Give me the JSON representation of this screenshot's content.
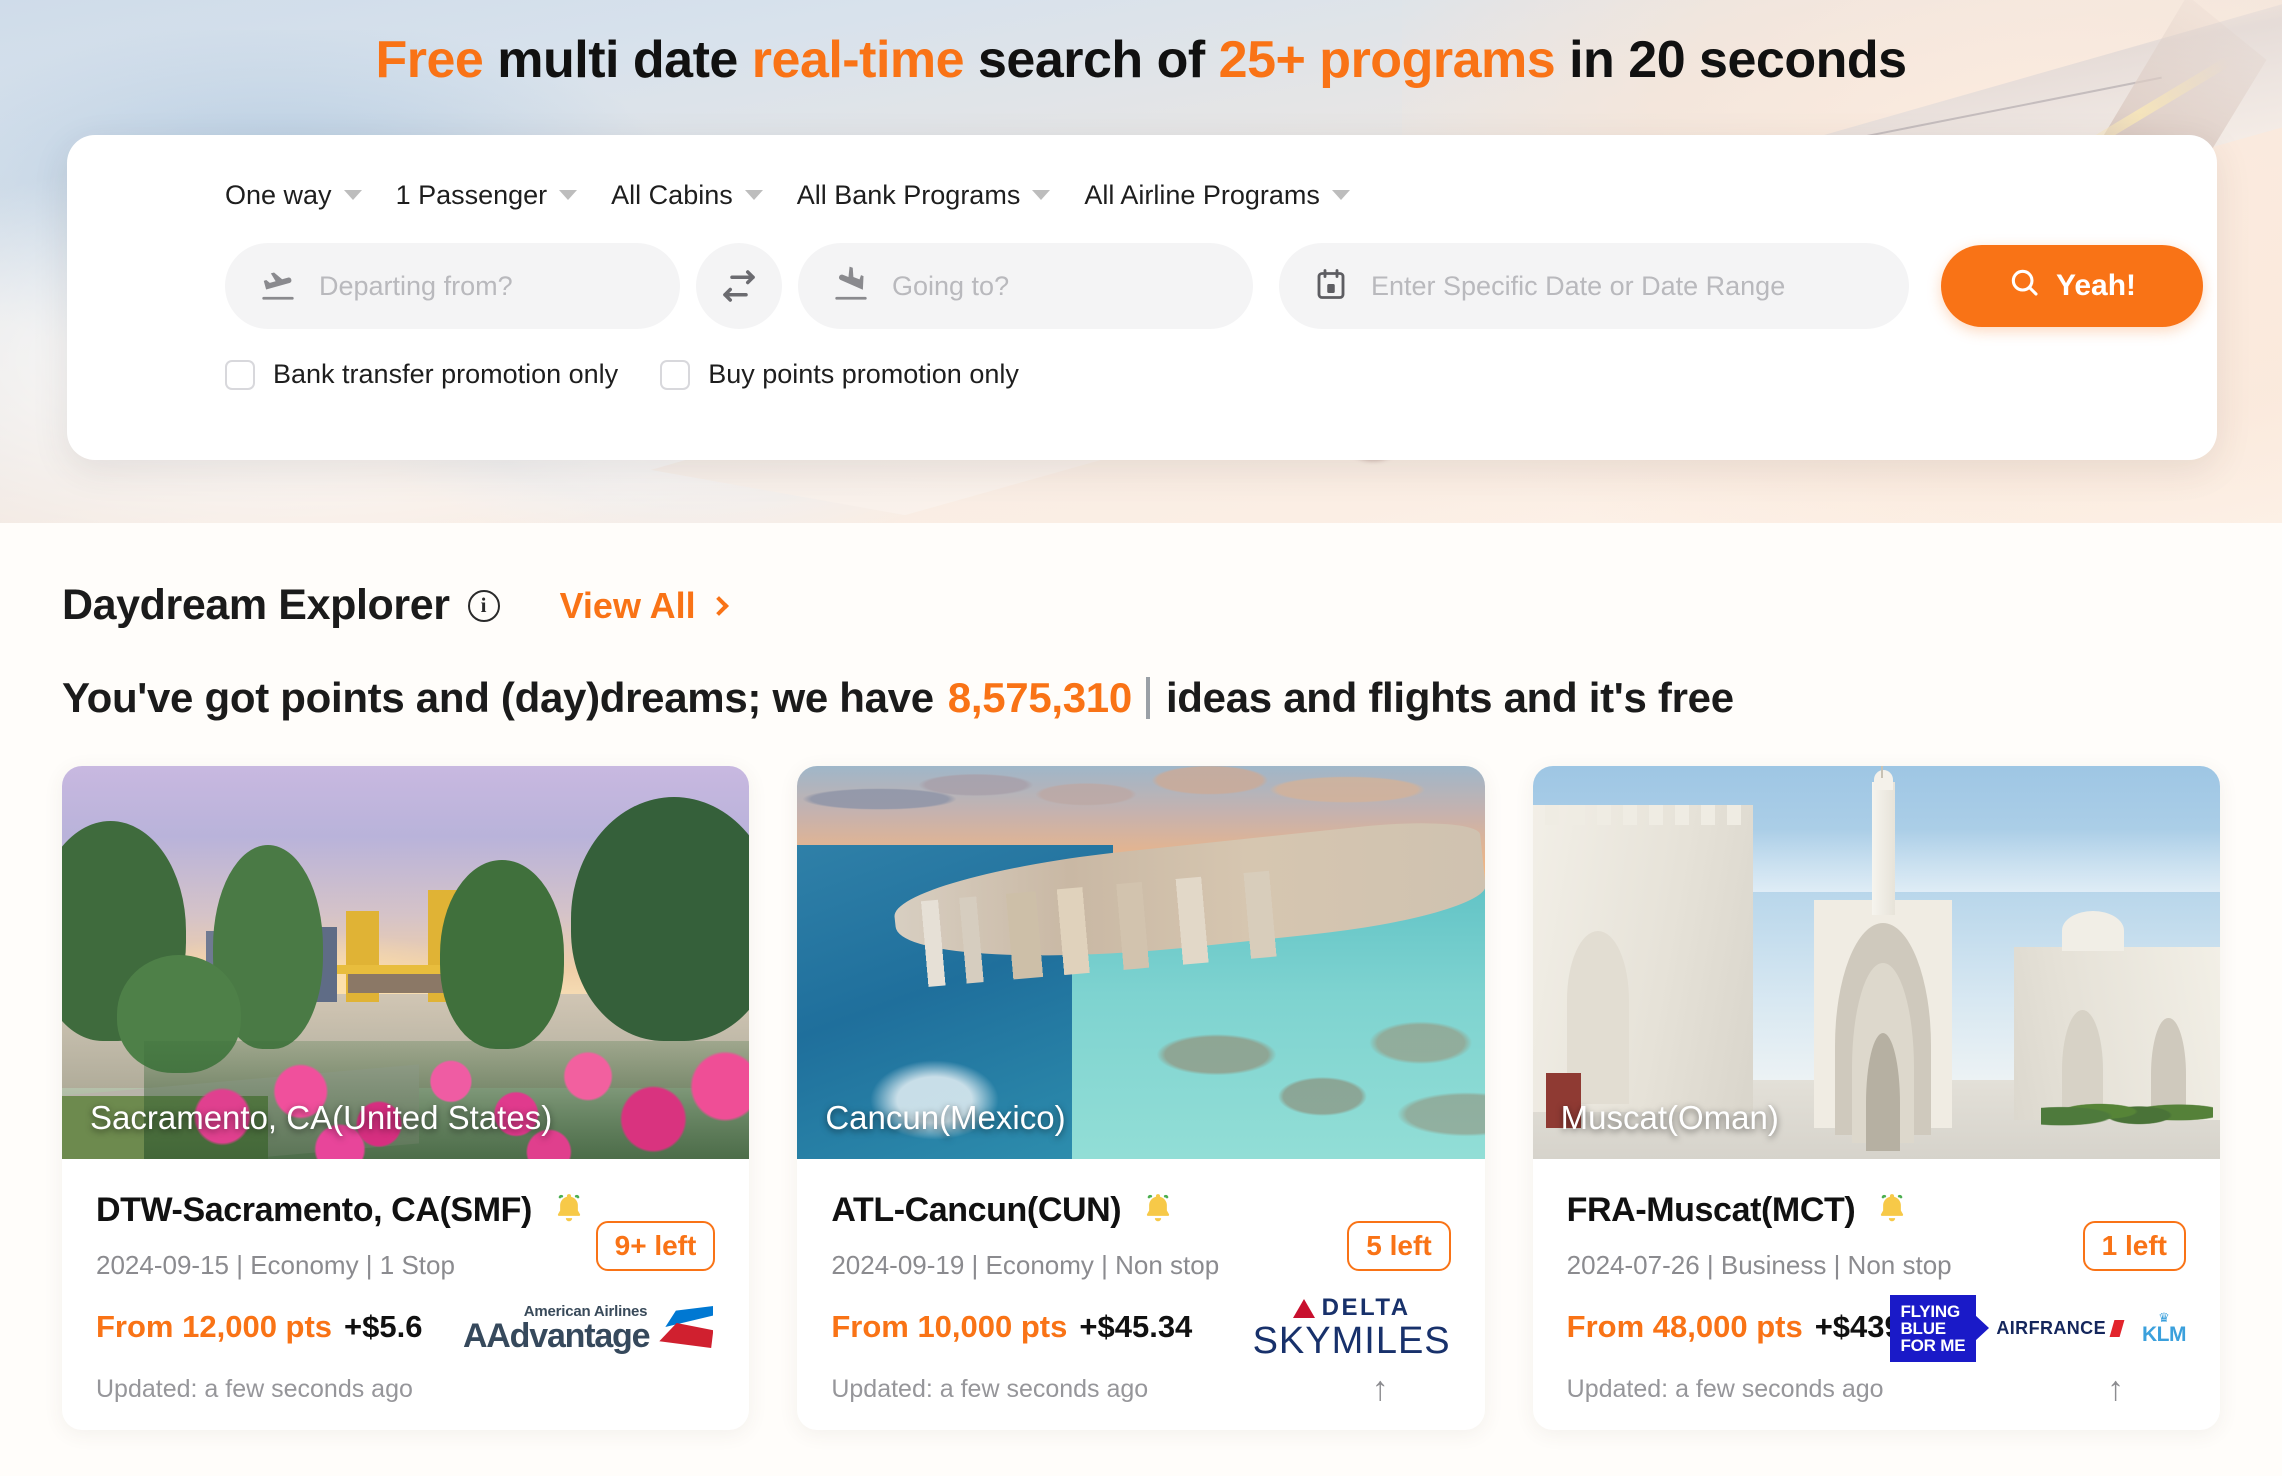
{
  "hero": {
    "headline_parts": [
      {
        "text": "Free ",
        "accent": true
      },
      {
        "text": "multi date ",
        "accent": false
      },
      {
        "text": "real-time ",
        "accent": true
      },
      {
        "text": "search of ",
        "accent": false
      },
      {
        "text": "25+ programs ",
        "accent": true
      },
      {
        "text": "in 20 seconds",
        "accent": false
      }
    ],
    "headline_plain": "Free multi date real-time search of 25+ programs in 20 seconds"
  },
  "search": {
    "selectors": [
      {
        "label": "One way",
        "name": "trip-type"
      },
      {
        "label": "1 Passenger",
        "name": "passengers"
      },
      {
        "label": "All Cabins",
        "name": "cabins"
      },
      {
        "label": "All Bank Programs",
        "name": "bank-programs"
      },
      {
        "label": "All Airline Programs",
        "name": "airline-programs"
      }
    ],
    "origin": {
      "value": "",
      "placeholder": "Departing from?"
    },
    "destination": {
      "value": "",
      "placeholder": "Going to?"
    },
    "date": {
      "value": "",
      "placeholder": "Enter Specific Date or Date Range"
    },
    "submit_label": "Yeah!",
    "checkboxes": [
      {
        "label": "Bank transfer promotion only",
        "checked": false
      },
      {
        "label": "Buy points promotion only",
        "checked": false
      }
    ]
  },
  "section": {
    "title": "Daydream Explorer",
    "info_glyph": "i",
    "view_all_label": "View All",
    "tagline_pre": "You've got points and (day)dreams; we have",
    "tagline_count": "8,575,310",
    "tagline_post": "ideas and flights and it's free"
  },
  "colors": {
    "accent": "#f97316",
    "text": "#1b1b1b",
    "muted": "#8b8b8f",
    "page_bg": "#fffdfa"
  },
  "cards": [
    {
      "destination_caption": "Sacramento, CA(United States)",
      "route": "DTW-Sacramento, CA(SMF)",
      "alert_icon": "bell-icon",
      "meta": "2024-09-15 | Economy | 1 Stop",
      "date": "2024-09-15",
      "cabin": "Economy",
      "stops": "1 Stop",
      "points": "From 12,000 pts",
      "cash": "+$5.6",
      "seats_left": "9+ left",
      "program": "AAdvantage",
      "program_sub": "American Airlines",
      "updated": "Updated: a few seconds ago",
      "has_share": false
    },
    {
      "destination_caption": "Cancun(Mexico)",
      "route": "ATL-Cancun(CUN)",
      "alert_icon": "bell-icon",
      "meta": "2024-09-19 | Economy | Non stop",
      "date": "2024-09-19",
      "cabin": "Economy",
      "stops": "Non stop",
      "points": "From 10,000 pts",
      "cash": "+$45.34",
      "seats_left": "5 left",
      "program": "SKYMILES",
      "program_sub": "DELTA",
      "updated": "Updated: a few seconds ago",
      "has_share": true
    },
    {
      "destination_caption": "Muscat(Oman)",
      "route": "FRA-Muscat(MCT)",
      "alert_icon": "bell-icon",
      "meta": "2024-07-26 | Business | Non stop",
      "date": "2024-07-26",
      "cabin": "Business",
      "stops": "Non stop",
      "points": "From 48,000 pts",
      "cash": "+$439.2",
      "seats_left": "1 left",
      "program": "FLYING BLUE FOR ME",
      "program_sub": "AIRFRANCE KLM",
      "updated": "Updated: a few seconds ago",
      "has_share": true
    }
  ]
}
